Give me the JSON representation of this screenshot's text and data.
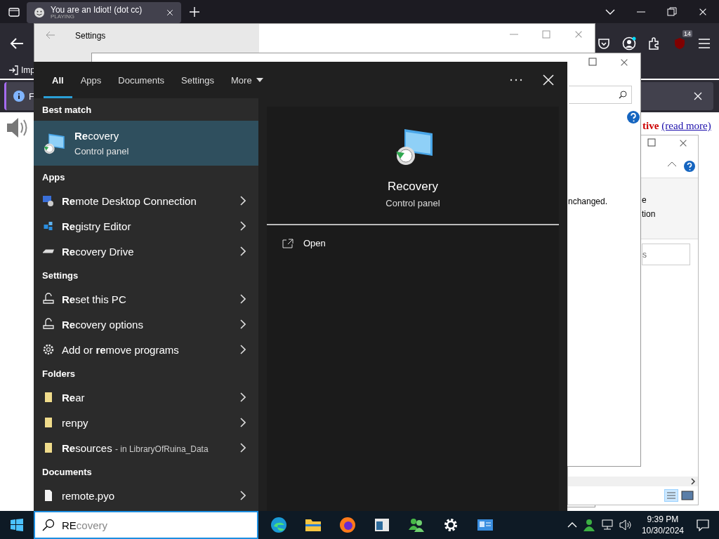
{
  "browser": {
    "tab": {
      "title": "You are an Idiot! (dot cc)",
      "subtitle": "PLAYING"
    },
    "extension_badge": "14",
    "bookmark": "Imp",
    "notification": "F",
    "page_text": "tive",
    "page_link": "(read more)"
  },
  "settings_window": {
    "title": "Settings"
  },
  "control_panel_window": {
    "text": "nchanged."
  },
  "explorer_window": {
    "ribbon_texts": [
      "e",
      "tion"
    ],
    "field_text": "s"
  },
  "search_panel": {
    "tabs": [
      {
        "label": "All",
        "selected": true
      },
      {
        "label": "Apps",
        "selected": false
      },
      {
        "label": "Documents",
        "selected": false
      },
      {
        "label": "Settings",
        "selected": false
      },
      {
        "label": "More",
        "selected": false
      }
    ],
    "best_match": {
      "heading": "Best match",
      "title": "**Re**covery",
      "subtitle": "Control panel",
      "selected": true
    },
    "sections": [
      {
        "heading": "Apps",
        "items": [
          {
            "kind": "remote-desktop",
            "label": "**Re**mote Desktop Connection"
          },
          {
            "kind": "registry",
            "label": "**Re**gistry Editor"
          },
          {
            "kind": "drive",
            "label": "**Re**covery Drive"
          }
        ]
      },
      {
        "heading": "Settings",
        "items": [
          {
            "kind": "reset",
            "label": "**Re**set this PC"
          },
          {
            "kind": "reset",
            "label": "**Re**covery options"
          },
          {
            "kind": "gear",
            "label": "Add or **re**move programs"
          }
        ]
      },
      {
        "heading": "Folders",
        "items": [
          {
            "kind": "folder",
            "label": "**Re**ar"
          },
          {
            "kind": "folder",
            "label": "renpy"
          },
          {
            "kind": "folder",
            "label": "**Re**sources",
            "detail": "- in LibraryOfRuina_Data"
          }
        ]
      },
      {
        "heading": "Documents",
        "items": [
          {
            "kind": "file",
            "label": "remote.pyo"
          }
        ]
      }
    ],
    "preview": {
      "title": "Recovery",
      "subtitle": "Control panel",
      "actions": [
        "Open"
      ]
    }
  },
  "taskbar": {
    "search": {
      "value": "RE",
      "suggestion": "covery"
    },
    "time": "9:39 PM",
    "date": "10/30/2024"
  }
}
